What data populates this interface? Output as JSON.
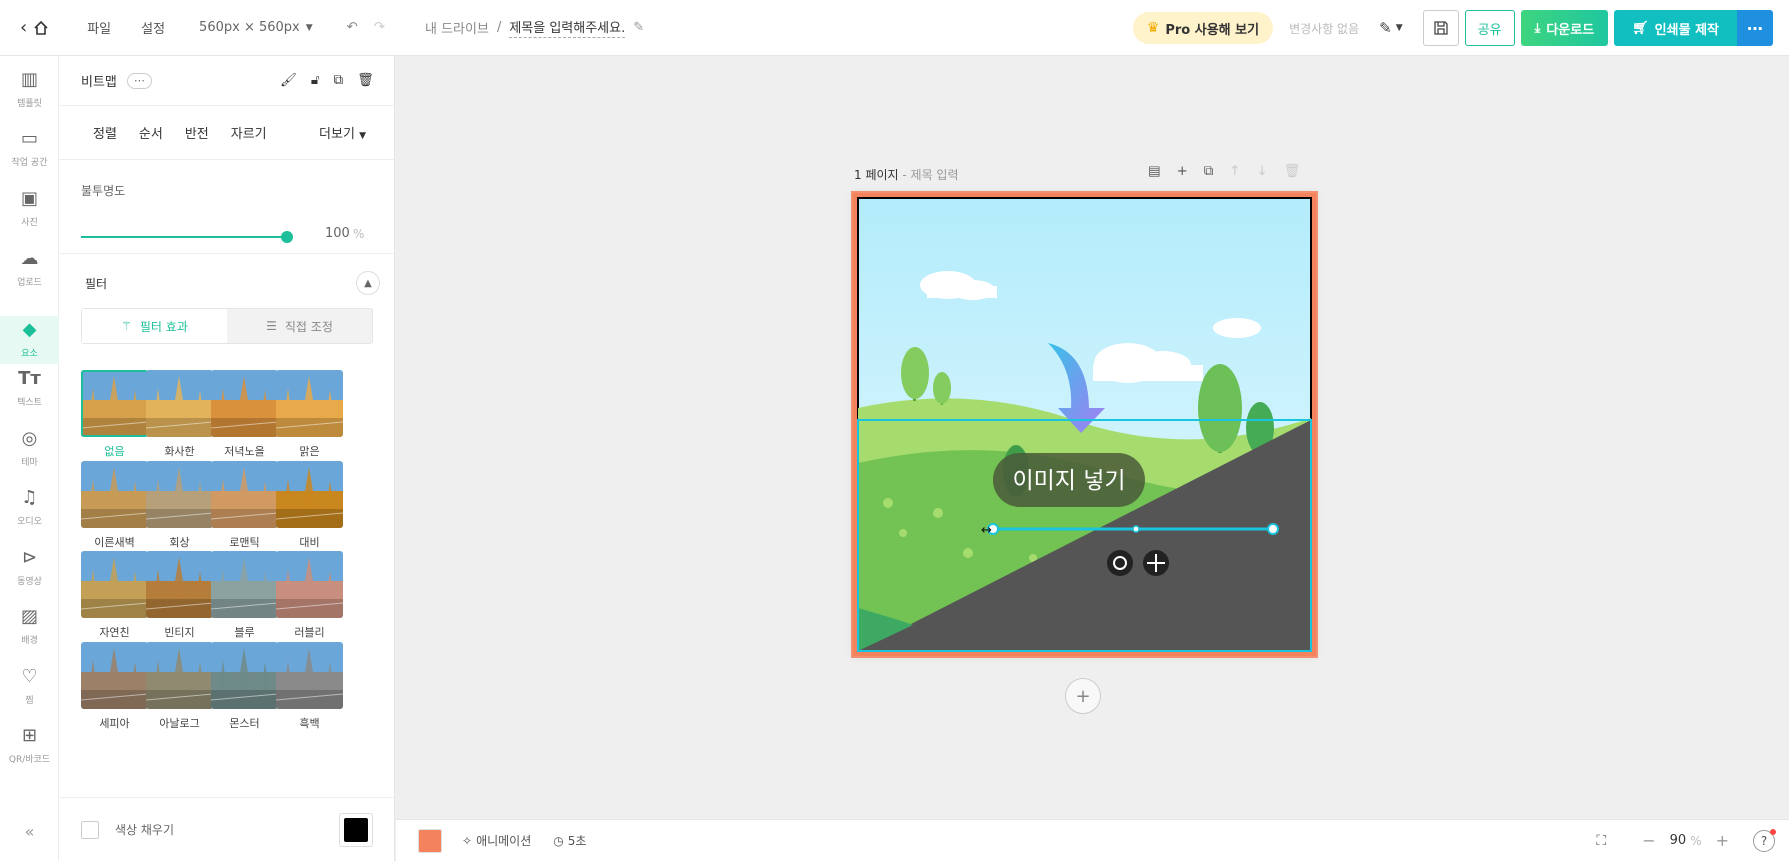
{
  "header": {
    "menu": [
      "파일",
      "설정"
    ],
    "size": "560px × 560px",
    "breadcrumb_root": "내 드라이브",
    "breadcrumb_sep": "/",
    "doc_title": "제목을 입력해주세요.",
    "pro_label": "Pro 사용해 보기",
    "changes_status": "변경사항 없음",
    "share_label": "공유",
    "download_label": "다운로드",
    "print_label": "인쇄물 제작",
    "more_label": "⋯"
  },
  "sidebar": {
    "items": [
      {
        "label": "템플릿",
        "icon": "template-icon"
      },
      {
        "label": "작업 공간",
        "icon": "workspace-icon"
      },
      {
        "label": "사진",
        "icon": "photo-icon"
      },
      {
        "label": "업로드",
        "icon": "upload-icon"
      },
      {
        "label": "요소",
        "icon": "elements-icon"
      },
      {
        "label": "텍스트",
        "icon": "text-icon"
      },
      {
        "label": "테마",
        "icon": "theme-icon"
      },
      {
        "label": "오디오",
        "icon": "audio-icon"
      },
      {
        "label": "동영상",
        "icon": "video-icon"
      },
      {
        "label": "배경",
        "icon": "background-icon"
      },
      {
        "label": "찜",
        "icon": "heart-icon"
      },
      {
        "label": "QR/바코드",
        "icon": "qr-icon"
      }
    ],
    "active_index": 4
  },
  "panel": {
    "title": "비트맵",
    "dots": "⋯",
    "tabs": [
      "정렬",
      "순서",
      "반전",
      "자르기"
    ],
    "more_label": "더보기",
    "opacity_label": "불투명도",
    "opacity_value": "100",
    "opacity_unit": "%",
    "opacity_level": 1.0,
    "filter_label": "필터",
    "filter_tabs": [
      "필터 효과",
      "직접 조정"
    ],
    "filters": [
      {
        "name": "없음",
        "tone": "#d7a04a"
      },
      {
        "name": "화사한",
        "tone": "#e3b35c"
      },
      {
        "name": "저녁노을",
        "tone": "#d9913c"
      },
      {
        "name": "맑은",
        "tone": "#e8a94a"
      },
      {
        "name": "이른새벽",
        "tone": "#c79a56"
      },
      {
        "name": "회상",
        "tone": "#b6a07a"
      },
      {
        "name": "로맨틱",
        "tone": "#d29a63"
      },
      {
        "name": "대비",
        "tone": "#c9871f"
      },
      {
        "name": "자연친",
        "tone": "#c3a056"
      },
      {
        "name": "빈티지",
        "tone": "#b57d3a"
      },
      {
        "name": "블루",
        "tone": "#8ca2a0"
      },
      {
        "name": "러블리",
        "tone": "#c98f7e"
      },
      {
        "name": "세피아",
        "tone": "#9c8068"
      },
      {
        "name": "아날로그",
        "tone": "#8f8a70"
      },
      {
        "name": "몬스터",
        "tone": "#6f8a88"
      },
      {
        "name": "흑백",
        "tone": "#8a8a8a"
      }
    ],
    "fill_label": "색상 채우기",
    "fill_color": "#000000"
  },
  "canvas": {
    "page_label": "1 페이지",
    "page_sub": " - 제목 입력",
    "image_label": "이미지 넣기",
    "add_page": "+"
  },
  "bottom": {
    "bg_color": "#f4825c",
    "animation_label": "애니메이션",
    "timer_label": "5초",
    "zoom_value": "90",
    "zoom_unit": "%",
    "help": "?"
  },
  "colors": {
    "accent": "#1dbf9a",
    "download_start": "#3ed47f",
    "print": "#12bfc0",
    "more": "#1f90e0"
  }
}
